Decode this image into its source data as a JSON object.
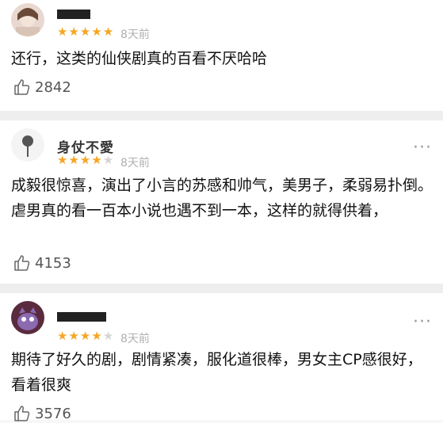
{
  "comments": [
    {
      "username": "",
      "rating": 5,
      "time": "8天前",
      "content": "还行，这类的仙侠剧真的百看不厌哈哈",
      "likes": "2842"
    },
    {
      "username": "身仗不愛",
      "rating": 4,
      "time": "8天前",
      "content": "成毅很惊喜，演出了小言的苏感和帅气，美男子，柔弱易扑倒。虐男真的看一百本小说也遇不到一本，这样的就得供着，",
      "likes": "4153"
    },
    {
      "username": "",
      "rating": 4,
      "time": "8天前",
      "content": "期待了好久的剧，剧情紧凑，服化道很棒，男女主CP感很好，看着很爽",
      "likes": "3576"
    }
  ],
  "more_glyph": "···",
  "star_glyph": "★",
  "colors": {
    "star_on": "#f5a623",
    "star_off": "#d5d5d5",
    "time": "#b0b0b0"
  },
  "icons": {
    "like": "thumbs-up-icon",
    "more": "more-icon"
  }
}
